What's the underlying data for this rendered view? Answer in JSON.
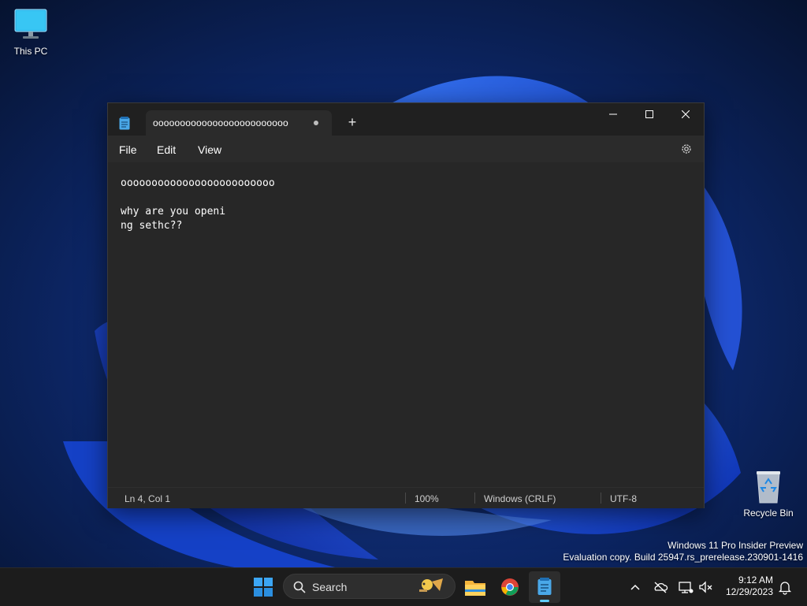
{
  "desktop": {
    "icons": [
      {
        "label": "This PC",
        "icon": "monitor-icon"
      },
      {
        "label": "Recycle Bin",
        "icon": "recycle-bin-icon"
      }
    ],
    "watermark": {
      "line1": "Windows 11 Pro Insider Preview",
      "line2": "Evaluation copy. Build 25947.rs_prerelease.230901-1416"
    }
  },
  "notepad": {
    "tab_title": "ooooooooooooooooooooooooo",
    "unsaved_dot": "modified-dot",
    "new_tab_label": "+",
    "caption": {
      "minimize": "—",
      "maximize": "☐",
      "close": "✕"
    },
    "menu": [
      "File",
      "Edit",
      "View"
    ],
    "content": "ooooooooooooooooooooooooo\n\nwhy are you openi\nng sethc??",
    "status": {
      "position": "Ln 4, Col 1",
      "zoom": "100%",
      "line_ending": "Windows (CRLF)",
      "encoding": "UTF-8"
    }
  },
  "taskbar": {
    "search_placeholder": "Search",
    "pinned": [
      "start-icon",
      "search-icon",
      "file-explorer-icon",
      "chrome-icon",
      "notepad-icon"
    ],
    "tray": [
      "chevron-up-icon",
      "onedrive-icon",
      "network-icon",
      "volume-muted-icon",
      "notification-bell-icon"
    ],
    "time": "9:12 AM",
    "date": "12/29/2023"
  },
  "colors": {
    "accent": "#60cdff",
    "window_bg": "#272727",
    "titlebar_bg": "#202020",
    "taskbar_bg": "#1c1c1c"
  }
}
